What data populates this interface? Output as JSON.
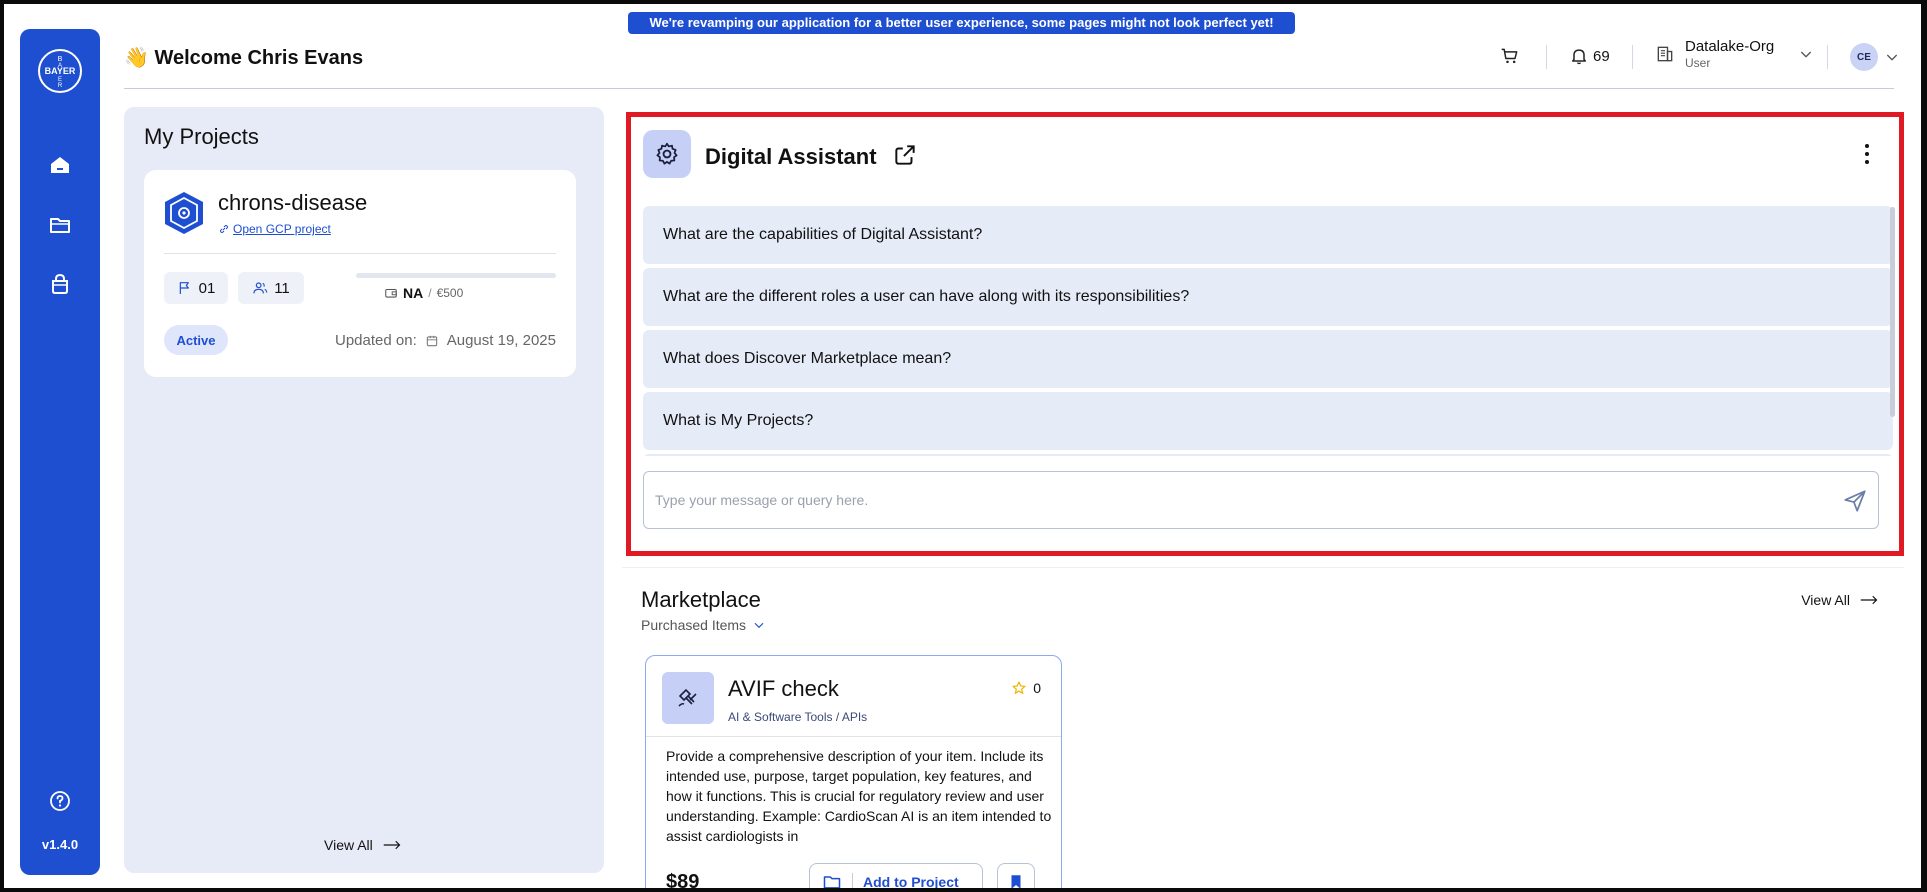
{
  "banner": {
    "text": "We're revamping our application for a better user experience, some pages might not look perfect yet!"
  },
  "sidebar": {
    "logo_text": "BAYER",
    "items": [
      {
        "name": "home",
        "icon": "home-icon"
      },
      {
        "name": "projects",
        "icon": "folder-icon"
      },
      {
        "name": "marketplace",
        "icon": "bag-icon"
      }
    ],
    "help_icon": "help-icon",
    "version": "v1.4.0"
  },
  "header": {
    "welcome_emoji": "👋",
    "welcome_text": "Welcome Chris Evans",
    "notifications_count": "69",
    "org_name": "Datalake-Org",
    "org_role": "User",
    "avatar_initials": "CE"
  },
  "projects": {
    "title": "My Projects",
    "view_all": "View All",
    "cards": [
      {
        "name": "chrons-disease",
        "link_text": "Open GCP project",
        "milestones": "01",
        "members": "11",
        "budget_used": "NA",
        "budget_total": "€500",
        "status": "Active",
        "updated_label": "Updated on:",
        "updated_date": "August 19, 2025"
      }
    ]
  },
  "assistant": {
    "title": "Digital Assistant",
    "questions": [
      "What are the capabilities of Digital Assistant?",
      "What are the different roles a user can have along with its responsibilities?",
      "What does Discover Marketplace mean?",
      "What is My Projects?"
    ],
    "input_placeholder": "Type your message or query here.",
    "input_value": ""
  },
  "marketplace": {
    "title": "Marketplace",
    "filter": "Purchased Items",
    "view_all": "View All",
    "items": [
      {
        "title": "AVIF check",
        "category": "AI & Software Tools / APIs",
        "rating": "0",
        "description": "Provide a comprehensive description of your item. Include its intended use, purpose, target population, key features, and how it functions. This is crucial for regulatory review and user understanding. Example: CardioScan AI is an item intended to assist cardiologists in",
        "price": "$89",
        "add_label": "Add to Project"
      }
    ]
  },
  "colors": {
    "brand": "#1f4fd1",
    "highlight_border": "#e01a22",
    "panel_bg": "#e7ebf7",
    "chip_bg": "#e6ebf8"
  }
}
